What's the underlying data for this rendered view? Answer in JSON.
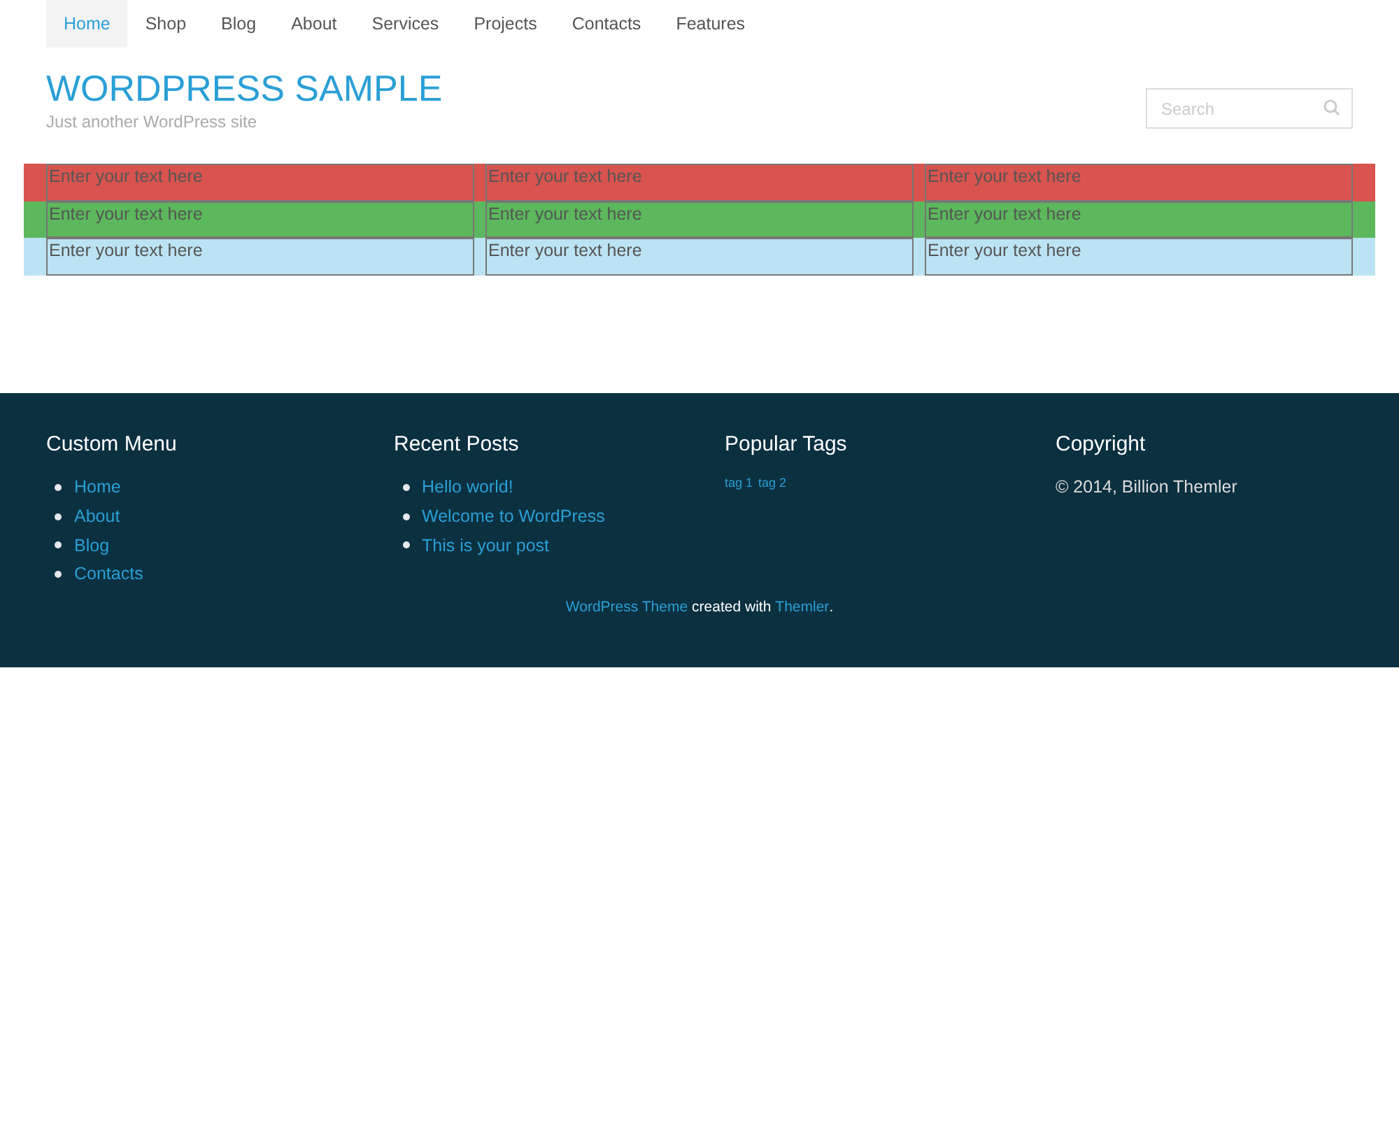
{
  "nav": [
    {
      "label": "Home",
      "selected": true
    },
    {
      "label": "Shop",
      "selected": false
    },
    {
      "label": "Blog",
      "selected": false
    },
    {
      "label": "About",
      "selected": false
    },
    {
      "label": "Services",
      "selected": false
    },
    {
      "label": "Projects",
      "selected": false
    },
    {
      "label": "Contacts",
      "selected": false
    },
    {
      "label": "Features",
      "selected": false
    }
  ],
  "header": {
    "title": "WORDPRESS SAMPLE",
    "tagline": "Just another WordPress site"
  },
  "search": {
    "placeholder": "Search"
  },
  "rows": [
    {
      "color": "#d9534f",
      "cells": [
        "Enter your text here",
        "Enter your text here",
        "Enter your text here"
      ]
    },
    {
      "color": "#5cb85c",
      "cells": [
        "Enter your text here",
        "Enter your text here",
        "Enter your text here"
      ]
    },
    {
      "color": "#bce3f3",
      "cells": [
        "Enter your text here",
        "Enter your text here",
        "Enter your text here"
      ]
    }
  ],
  "footer": {
    "custom_menu": {
      "title": "Custom Menu",
      "items": [
        "Home",
        "About",
        "Blog",
        "Contacts"
      ]
    },
    "recent_posts": {
      "title": "Recent Posts",
      "items": [
        "Hello world!",
        "Welcome to WordPress",
        "This is your post"
      ]
    },
    "popular_tags": {
      "title": "Popular Tags",
      "tags": [
        "tag 1",
        "tag 2"
      ]
    },
    "copyright": {
      "title": "Copyright",
      "text": "© 2014, Billion Themler"
    },
    "credit": {
      "link_1": "WordPress Theme",
      "middle": "created with",
      "link_2": "Themler",
      "end": "."
    }
  }
}
